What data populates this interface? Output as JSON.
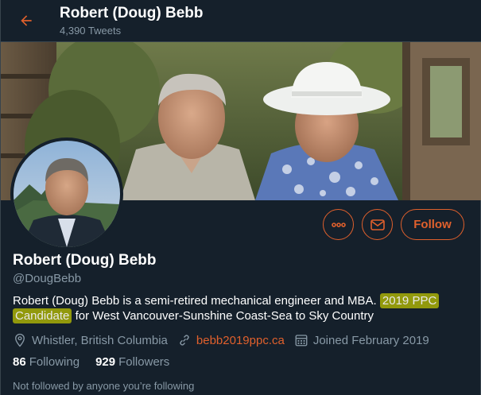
{
  "header": {
    "title": "Robert (Doug) Bebb",
    "tweet_count": "4,390 Tweets"
  },
  "profile": {
    "name": "Robert (Doug) Bebb",
    "handle": "@DougBebb",
    "bio_part1": "Robert (Doug) Bebb is a semi-retired mechanical engineer and MBA.",
    "bio_highlight1": "2019 PPC",
    "bio_highlight2": "Candidate",
    "bio_part2": "for West Vancouver-Sunshine Coast-Sea to Sky Country",
    "location": "Whistler, British Columbia",
    "website": "bebb2019ppc.ca",
    "joined": "Joined February 2019"
  },
  "actions": {
    "follow_label": "Follow",
    "more_icon": "more-icon",
    "message_icon": "envelope-icon"
  },
  "stats": {
    "following_count": "86",
    "following_label": "Following",
    "followers_count": "929",
    "followers_label": "Followers"
  },
  "footer_note": "Not followed by anyone you’re following",
  "colors": {
    "background": "#15202b",
    "accent": "#e0602c",
    "secondary_text": "#8899a6",
    "highlight": "#c4c800"
  }
}
